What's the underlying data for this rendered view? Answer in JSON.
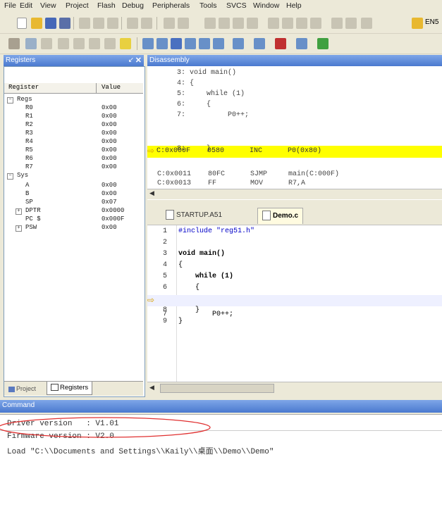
{
  "menu": [
    "File",
    "Edit",
    "View",
    "Project",
    "Flash",
    "Debug",
    "Peripherals",
    "Tools",
    "SVCS",
    "Window",
    "Help"
  ],
  "toolbar1_tail_label": "EN5",
  "registers_panel": {
    "title": "Registers",
    "col_register": "Register",
    "col_value": "Value",
    "groups": [
      {
        "name": "Regs",
        "items": [
          {
            "name": "R0",
            "value": "0x00"
          },
          {
            "name": "R1",
            "value": "0x00"
          },
          {
            "name": "R2",
            "value": "0x00"
          },
          {
            "name": "R3",
            "value": "0x00"
          },
          {
            "name": "R4",
            "value": "0x00"
          },
          {
            "name": "R5",
            "value": "0x00"
          },
          {
            "name": "R6",
            "value": "0x00"
          },
          {
            "name": "R7",
            "value": "0x00"
          }
        ]
      },
      {
        "name": "Sys",
        "items": [
          {
            "name": "A",
            "value": "0x00"
          },
          {
            "name": "B",
            "value": "0x00"
          },
          {
            "name": "SP",
            "value": "0x07"
          },
          {
            "name": "DPTR",
            "value": "0x0000"
          },
          {
            "name": "PC $",
            "value": "0x000F"
          },
          {
            "name": "PSW",
            "value": "0x00"
          }
        ]
      }
    ],
    "bottom_tabs": [
      "Project",
      "Registers"
    ]
  },
  "disassembly": {
    "title": "Disassembly",
    "lines": [
      "       3: void main()",
      "       4: {",
      "       5:     while (1)",
      "       6:     {",
      "       7:          P0++;",
      "C:0x000F    0580      INC      P0(0x80)",
      "       8:     }",
      "C:0x0011    80FC      SJMP     main(C:000F)",
      "C:0x0013    FF        MOV      R7,A"
    ]
  },
  "editor": {
    "tabs": [
      "STARTUP.A51",
      "Demo.c"
    ],
    "lines": [
      {
        "n": "1",
        "t": "#include \"reg51.h\""
      },
      {
        "n": "2",
        "t": ""
      },
      {
        "n": "3",
        "t": "void main()"
      },
      {
        "n": "4",
        "t": "{"
      },
      {
        "n": "5",
        "t": "    while (1)"
      },
      {
        "n": "6",
        "t": "    {"
      },
      {
        "n": "7",
        "t": "        P0++;"
      },
      {
        "n": "8",
        "t": "    }"
      },
      {
        "n": "9",
        "t": "}"
      }
    ]
  },
  "command": {
    "title": "Command",
    "lines": [
      "Driver version   : V1.01",
      "Firmware version : V2.0",
      "Load \"C:\\\\Documents and Settings\\\\Kaily\\\\桌面\\\\Demo\\\\Demo\""
    ]
  },
  "colors": {
    "highlight": "#ffff00",
    "keyword": "#0000c8",
    "header_blue": "#4a79cf",
    "annotation": "#e03030"
  }
}
